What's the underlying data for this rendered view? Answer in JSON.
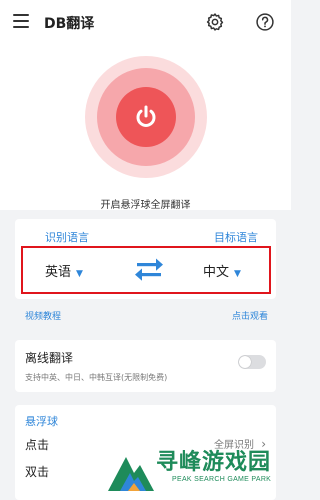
{
  "header": {
    "title": "DB翻译",
    "icons": [
      "menu-icon",
      "gear-icon",
      "help-icon"
    ]
  },
  "hero": {
    "caption": "开启悬浮球全屏翻译",
    "icon": "power-icon"
  },
  "language": {
    "source_heading": "识别语言",
    "target_heading": "目标语言",
    "source_value": "英语",
    "target_value": "中文",
    "swap_icon": "swap-icon"
  },
  "video": {
    "left": "视频教程",
    "right": "点击观看"
  },
  "offline": {
    "title": "离线翻译",
    "subtitle": "支持中英、中日、中韩互译(无限制免费)",
    "enabled": false
  },
  "floating_ball": {
    "title": "悬浮球",
    "click_label": "点击",
    "click_value": "全屏识别",
    "double_click_label": "双击"
  },
  "watermark": {
    "text": "寻峰游戏园",
    "subtext": "PEAK SEARCH GAME PARK"
  },
  "colors": {
    "accent": "#2f86d9",
    "power_red": "#ee5558",
    "highlight_box": "#e0151c"
  }
}
